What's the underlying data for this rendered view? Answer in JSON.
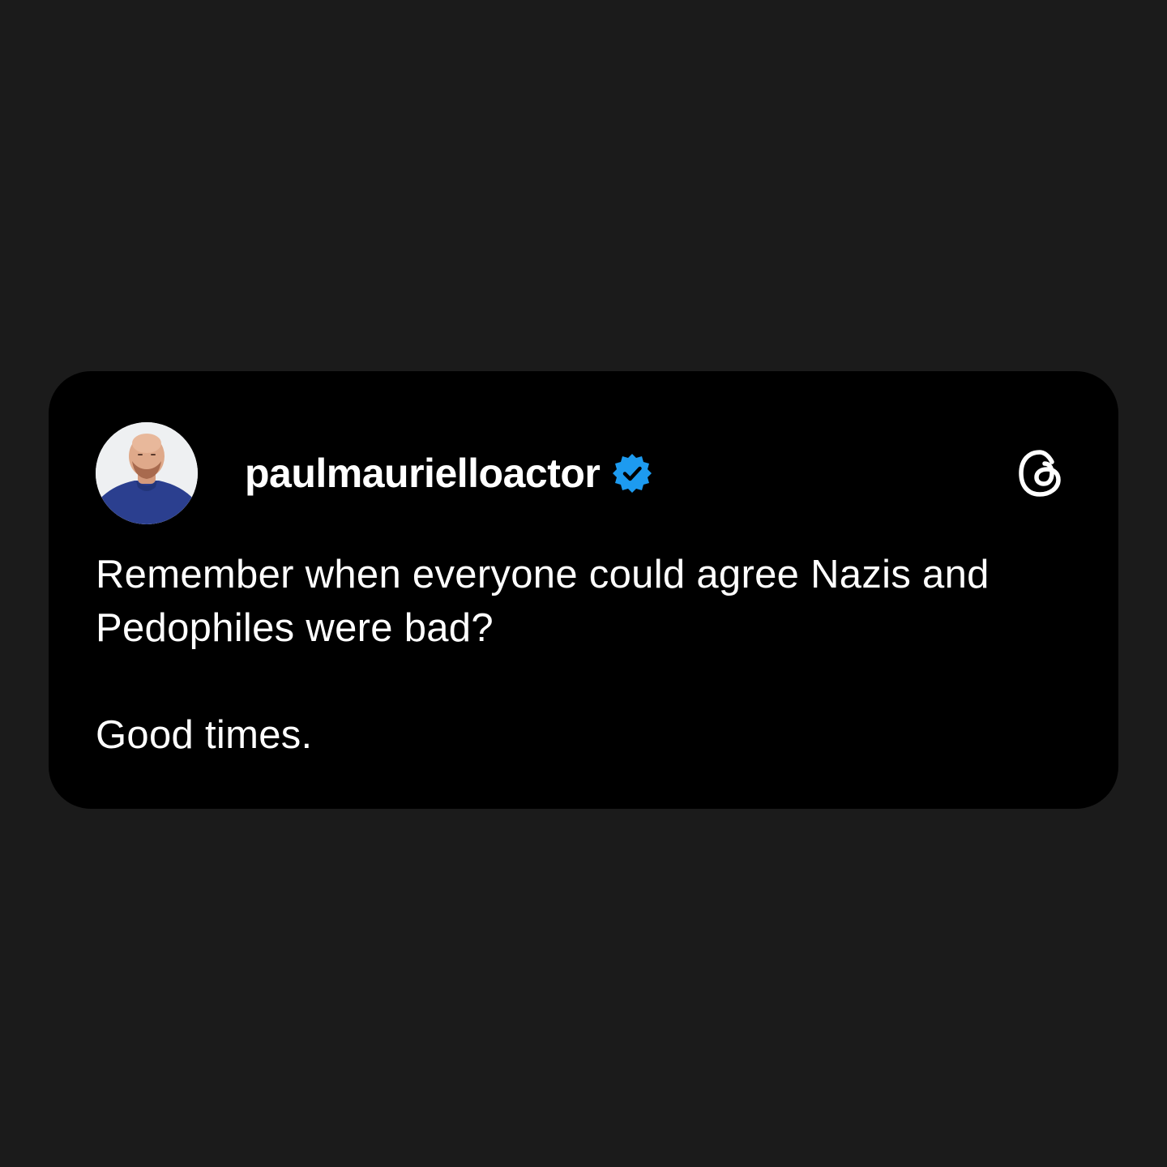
{
  "post": {
    "username": "paulmaurielloactor",
    "verified": true,
    "avatar": "profile-photo",
    "platform_icon": "threads-logo-icon",
    "text_lines": [
      "Remember when everyone could agree Nazis and",
      "Pedophiles were bad?"
    ],
    "closing_line": "Good times."
  },
  "colors": {
    "page_background": "#1b1b1b",
    "card_background": "#000000",
    "text": "#ffffff",
    "verified_badge": "#1d9bf0"
  }
}
